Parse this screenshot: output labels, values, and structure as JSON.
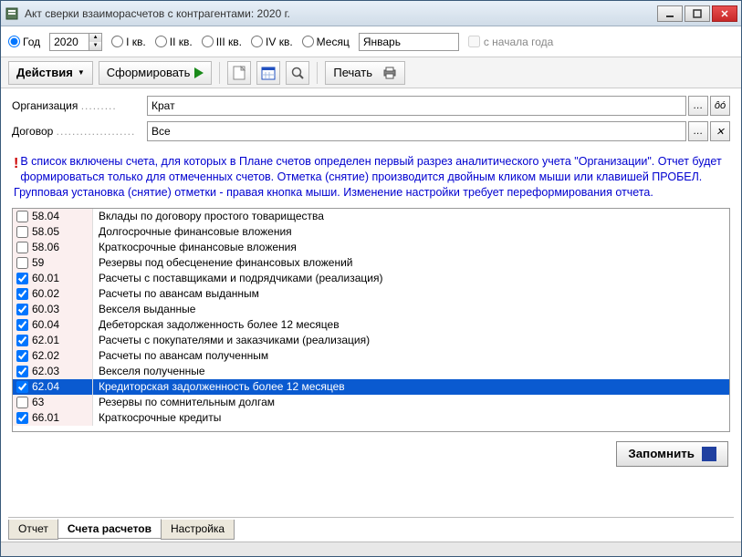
{
  "window": {
    "title": "Акт сверки взаиморасчетов с контрагентами: 2020 г."
  },
  "period": {
    "year_label": "Год",
    "year_value": "2020",
    "q1": "I кв.",
    "q2": "II кв.",
    "q3": "III кв.",
    "q4": "IV кв.",
    "month_label": "Месяц",
    "month_value": "Январь",
    "from_year": "с начала года"
  },
  "toolbar": {
    "actions": "Действия",
    "form": "Сформировать",
    "print": "Печать"
  },
  "form": {
    "org_label": "Организация",
    "org_value": "Крат",
    "contract_label": "Договор",
    "contract_value": "Все"
  },
  "info_text": "В список включены счета, для которых в Плане счетов определен первый разрез аналитического учета \"Организации\". Отчет будет формироваться только для отмеченных счетов. Отметка (снятие) производится двойным кликом мыши или клавишей ПРОБЕЛ. Групповая установка (снятие) отметки - правая кнопка мыши. Изменение настройки требует переформирования отчета.",
  "accounts": [
    {
      "code": "58.04",
      "desc": "Вклады по договору простого товарищества",
      "checked": false,
      "sel": false
    },
    {
      "code": "58.05",
      "desc": "Долгосрочные финансовые вложения",
      "checked": false,
      "sel": false
    },
    {
      "code": "58.06",
      "desc": "Краткосрочные финансовые вложения",
      "checked": false,
      "sel": false
    },
    {
      "code": "59",
      "desc": "Резервы под обесценение финансовых вложений",
      "checked": false,
      "sel": false
    },
    {
      "code": "60.01",
      "desc": "Расчеты с поставщиками и подрядчиками (реализация)",
      "checked": true,
      "sel": false
    },
    {
      "code": "60.02",
      "desc": "Расчеты по авансам выданным",
      "checked": true,
      "sel": false
    },
    {
      "code": "60.03",
      "desc": "Векселя выданные",
      "checked": true,
      "sel": false
    },
    {
      "code": "60.04",
      "desc": "Дебеторская задолженность более 12 месяцев",
      "checked": true,
      "sel": false
    },
    {
      "code": "62.01",
      "desc": "Расчеты с покупателями и заказчиками (реализация)",
      "checked": true,
      "sel": false
    },
    {
      "code": "62.02",
      "desc": "Расчеты по авансам полученным",
      "checked": true,
      "sel": false
    },
    {
      "code": "62.03",
      "desc": "Векселя полученные",
      "checked": true,
      "sel": false
    },
    {
      "code": "62.04",
      "desc": "Кредиторская задолженность более 12 месяцев",
      "checked": true,
      "sel": true
    },
    {
      "code": "63",
      "desc": "Резервы по сомнительным долгам",
      "checked": false,
      "sel": false
    },
    {
      "code": "66.01",
      "desc": "Краткосрочные кредиты",
      "checked": true,
      "sel": false
    }
  ],
  "save_label": "Запомнить",
  "tabs": {
    "report": "Отчет",
    "accounts": "Счета расчетов",
    "settings": "Настройка"
  }
}
